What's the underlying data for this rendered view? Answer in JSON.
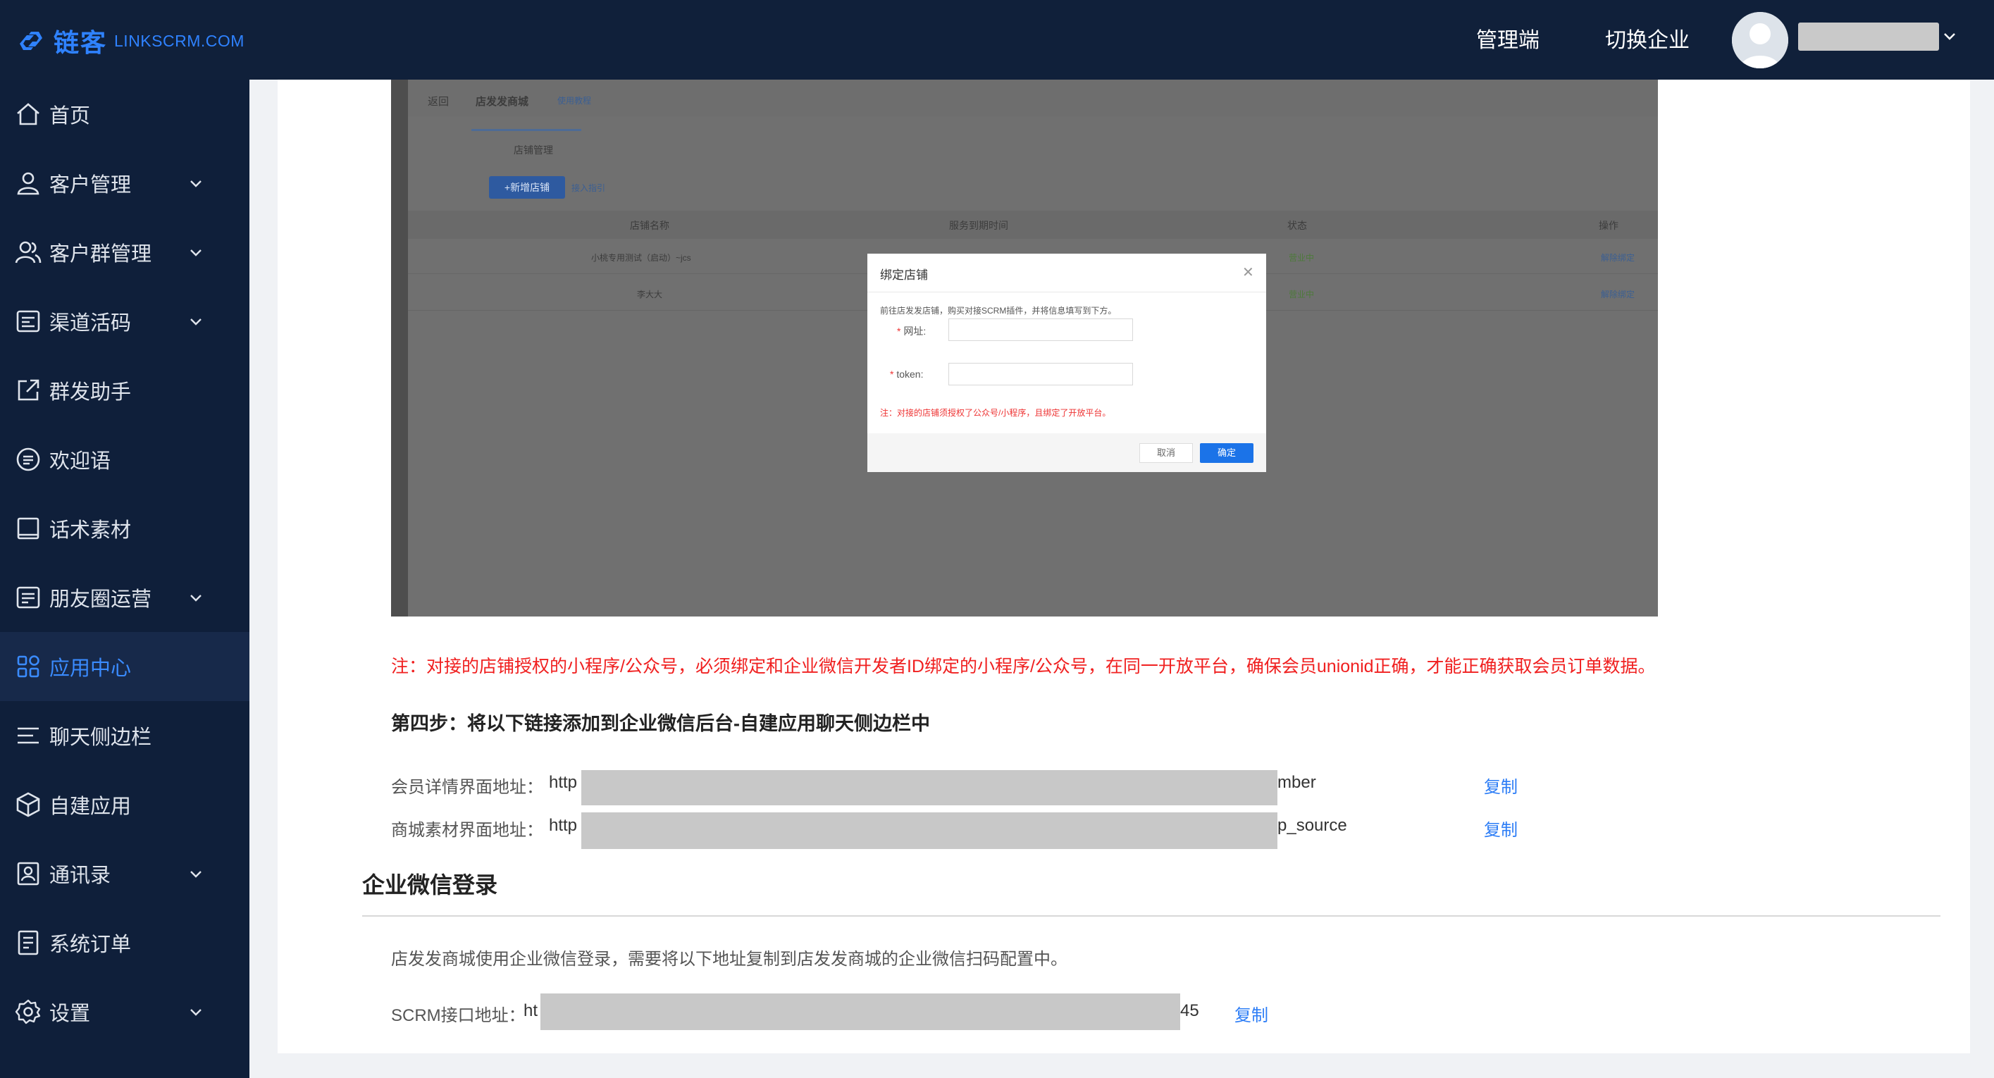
{
  "header": {
    "brand_cn": "链客",
    "brand_en": "LINKSCRM.COM",
    "nav": [
      "管理端",
      "切换企业"
    ]
  },
  "sidebar": {
    "items": [
      {
        "label": "首页",
        "icon": "home-icon",
        "expandable": false,
        "active": false
      },
      {
        "label": "客户管理",
        "icon": "user-icon",
        "expandable": true,
        "active": false
      },
      {
        "label": "客户群管理",
        "icon": "group-icon",
        "expandable": true,
        "active": false
      },
      {
        "label": "渠道活码",
        "icon": "qrcode-icon",
        "expandable": true,
        "active": false
      },
      {
        "label": "群发助手",
        "icon": "share-icon",
        "expandable": false,
        "active": false
      },
      {
        "label": "欢迎语",
        "icon": "message-icon",
        "expandable": false,
        "active": false
      },
      {
        "label": "话术素材",
        "icon": "material-icon",
        "expandable": false,
        "active": false
      },
      {
        "label": "朋友圈运营",
        "icon": "moments-icon",
        "expandable": true,
        "active": false
      },
      {
        "label": "应用中心",
        "icon": "apps-icon",
        "expandable": false,
        "active": true
      },
      {
        "label": "聊天侧边栏",
        "icon": "list-icon",
        "expandable": false,
        "active": false
      },
      {
        "label": "自建应用",
        "icon": "cube-icon",
        "expandable": false,
        "active": false
      },
      {
        "label": "通讯录",
        "icon": "contacts-icon",
        "expandable": true,
        "active": false
      },
      {
        "label": "系统订单",
        "icon": "order-icon",
        "expandable": false,
        "active": false
      },
      {
        "label": "设置",
        "icon": "gear-icon",
        "expandable": true,
        "active": false
      }
    ]
  },
  "screenshot": {
    "back": "返回",
    "page_title": "店发发商城",
    "page_sub": "使用教程",
    "tab": "店铺管理",
    "add_button": "+新增店铺",
    "access_guide": "接入指引",
    "columns": [
      "店铺名称",
      "服务到期时间",
      "状态",
      "操作"
    ],
    "rows": [
      {
        "name": "小桃专用测试（启动）~jcs",
        "status": "营业中",
        "action": "解除绑定"
      },
      {
        "name": "李大大",
        "status": "营业中",
        "action": "解除绑定"
      }
    ],
    "dialog": {
      "title": "绑定店铺",
      "desc": "前往店发发店铺，购买对接SCRM插件，并将信息填写到下方。",
      "url_label": "网址:",
      "token_label": "token:",
      "note": "注：对接的店铺须授权了公众号/小程序，且绑定了开放平台。",
      "cancel": "取消",
      "confirm": "确定"
    }
  },
  "main": {
    "note": "注：对接的店铺授权的小程序/公众号，必须绑定和企业微信开发者ID绑定的小程序/公众号，在同一开放平台，确保会员unionid正确，才能正确获取会员订单数据。",
    "step4": "第四步：将以下链接添加到企业微信后台-自建应用聊天侧边栏中",
    "links": [
      {
        "label": "会员详情界面地址：",
        "prefix": "http",
        "suffix": "mber",
        "copy": "复制"
      },
      {
        "label": "商城素材界面地址：",
        "prefix": "http",
        "suffix": "p_source",
        "copy": "复制"
      }
    ],
    "section_title": "企业微信登录",
    "section_desc": "店发发商城使用企业微信登录，需要将以下地址复制到店发发商城的企业微信扫码配置中。",
    "api": {
      "label": "SCRM接口地址：",
      "prefix": "ht",
      "suffix": "45",
      "copy": "复制"
    }
  },
  "colors": {
    "topbar": "#10203a",
    "sidebar": "#0f1f3a",
    "accent": "#2b7cf6",
    "warning": "#f02020"
  }
}
